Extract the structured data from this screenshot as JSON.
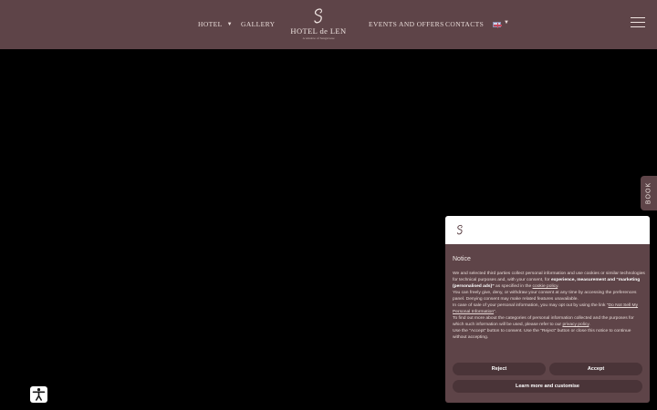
{
  "header": {
    "nav": {
      "hotel": "HOTEL",
      "gallery": "GALLERY",
      "events": "EVENTS AND OFFERS",
      "contacts": "CONTACTS"
    },
    "logo": {
      "title": "HOTEL de LEN",
      "subtitle": "A window of Sangiovese"
    },
    "language_icon": "uk-flag-icon",
    "menu_icon": "hamburger-icon"
  },
  "book_tab": {
    "label": "BOOK"
  },
  "accessibility_icon": "accessibility-person-icon",
  "cookie": {
    "title": "Notice",
    "p1_a": "We and selected third parties collect personal information and use cookies or similar technologies for technical purposes and, with your consent, for ",
    "p1_bold": "experience, measurement and “marketing (personalised ads)”",
    "p1_b": " as specified in the ",
    "cookie_policy_link": "cookie policy",
    "p1_c": ".",
    "p2": "You can freely give, deny, or withdraw your consent at any time by accessing the preferences panel. Denying consent may make related features unavailable.",
    "p3_a": "In case of sale of your personal information, you may opt out by using the link “",
    "do_not_sell_link": "Do Not Sell My Personal Information",
    "p3_b": "”.",
    "p4_a": "To find out more about the categories of personal information collected and the purposes for which such information will be used, please refer to our ",
    "privacy_link": "privacy policy",
    "p4_b": ".",
    "p5": "Use the “Accept” button to consent. Use the “Reject” button or close this notice to continue without accepting.",
    "reject_label": "Reject",
    "accept_label": "Accept",
    "learn_label": "Learn more and customise"
  },
  "colors": {
    "brand": "#5e4448",
    "button": "#4a3438",
    "background": "#000000"
  }
}
